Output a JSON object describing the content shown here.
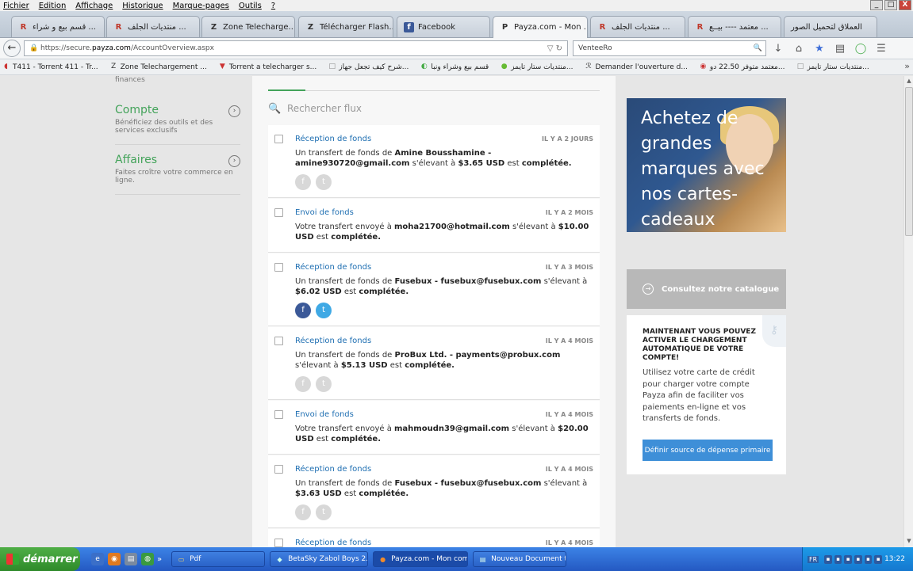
{
  "menubar": {
    "items": [
      "Fichier",
      "Edition",
      "Affichage",
      "Historique",
      "Marque-pages",
      "Outils",
      "?"
    ]
  },
  "window_controls": {
    "minimize": "_",
    "maximize": "□",
    "close": "X"
  },
  "tabs": [
    {
      "label": "قسم بيع و شراء ...",
      "icon": "R",
      "active": false
    },
    {
      "label": "منتديات الجلف ...",
      "icon": "R",
      "active": false
    },
    {
      "label": "Zone Telecharge...",
      "icon": "Z",
      "active": false
    },
    {
      "label": "Télécharger Flash...",
      "icon": "Z",
      "active": false
    },
    {
      "label": "Facebook",
      "icon": "f",
      "active": false
    },
    {
      "label": "Payza.com - Mon ...",
      "icon": "P",
      "active": true,
      "close": "×"
    },
    {
      "label": "منتديات الجلف ...",
      "icon": "R",
      "active": false
    },
    {
      "label": "معتمد ---- بيــع ...",
      "icon": "R",
      "active": false
    },
    {
      "label": "العملاق لتحميل الصور",
      "icon": "",
      "active": false
    }
  ],
  "nav": {
    "back": "←",
    "url_prefix": "https://secure.",
    "url_domain": "payza.com",
    "url_path": "/AccountOverview.aspx",
    "url_controls": "▽  ↻",
    "search_value": "VenteeRo",
    "search_icon": "🔍",
    "icons": [
      "↓",
      "⌂",
      "★",
      "▤",
      "◯",
      "☰"
    ]
  },
  "bookmarks": [
    "T411 - Torrent 411 - Tr...",
    "Zone Telechargement ...",
    "Torrent a telecharger s...",
    "شرح كيف تجعل جهاز...",
    "قسم بيع وشراء ونبا",
    "منتديات ستار تايمز...",
    "Demander l'ouverture d...",
    "معتمد متوفر 22.50 دو...",
    "منتديات ستار تايمز..."
  ],
  "bookmarks_more": "»",
  "sidebar": {
    "cut_text": "finances",
    "items": [
      {
        "title": "Compte",
        "desc": "Bénéficiez des outils et des services exclusifs",
        "arrow": "›"
      },
      {
        "title": "Affaires",
        "desc": "Faites croître votre commerce en ligne.",
        "arrow": "›"
      }
    ]
  },
  "feed": {
    "search_icon": "🔍",
    "search_placeholder": "Rechercher flux",
    "items": [
      {
        "title": "Réception de fonds",
        "date": "IL Y A 2 JOURS",
        "pre": "Un transfert de fonds de ",
        "party": "Amine Bousshamine - amine930720@gmail.com",
        "mid": " s'élevant à ",
        "amount": "$3.65 USD",
        "post": " est ",
        "status": "complétée.",
        "social": "grey"
      },
      {
        "title": "Envoi de fonds",
        "date": "IL Y A 2 MOIS",
        "pre": "Votre transfert envoyé à ",
        "party": "moha21700@hotmail.com",
        "mid": " s'élevant à ",
        "amount": "$10.00 USD",
        "post": " est ",
        "status": "complétée.",
        "social": "none"
      },
      {
        "title": "Réception de fonds",
        "date": "IL Y A 3 MOIS",
        "pre": "Un transfert de fonds de ",
        "party": "Fusebux - fusebux@fusebux.com",
        "mid": " s'élevant à ",
        "amount": "$6.02 USD",
        "post": " est ",
        "status": "complétée.",
        "social": "color"
      },
      {
        "title": "Réception de fonds",
        "date": "IL Y A 4 MOIS",
        "pre": "Un transfert de fonds de ",
        "party": "ProBux Ltd. - payments@probux.com",
        "mid": " s'élevant à ",
        "amount": "$5.13 USD",
        "post": " est ",
        "status": "complétée.",
        "social": "grey"
      },
      {
        "title": "Envoi de fonds",
        "date": "IL Y A 4 MOIS",
        "pre": "Votre transfert envoyé à ",
        "party": "mahmoudn39@gmail.com",
        "mid": " s'élevant à ",
        "amount": "$20.00 USD",
        "post": " est ",
        "status": "complétée.",
        "social": "none"
      },
      {
        "title": "Réception de fonds",
        "date": "IL Y A 4 MOIS",
        "pre": "Un transfert de fonds de ",
        "party": "Fusebux - fusebux@fusebux.com",
        "mid": " s'élevant à ",
        "amount": "$3.63 USD",
        "post": " est ",
        "status": "complétée.",
        "social": "grey"
      },
      {
        "title": "Réception de fonds",
        "date": "IL Y A 4 MOIS",
        "pre": "",
        "party": "",
        "mid": "",
        "amount": "",
        "post": "",
        "status": "",
        "social": "none"
      }
    ],
    "social_labels": {
      "facebook": "f",
      "twitter": "t"
    }
  },
  "ad": {
    "text": "Achetez de grandes marques avec nos cartes-cadeaux"
  },
  "catalog": {
    "icon": "→",
    "label": "Consultez notre catalogue"
  },
  "promo": {
    "title": "MAINTENANT VOUS POUVEZ ACTIVER LE CHARGEMENT AUTOMATIQUE DE VOTRE COMPTE!",
    "desc": "Utilisez votre carte de crédit pour charger votre compte Payza afin de faciliter vos paiements en-ligne et vos transferts de fonds.",
    "button": "Définir source de dépense primaire"
  },
  "scrollbar": {
    "up": "▲",
    "down": "▼"
  },
  "taskbar": {
    "start": "démarrer",
    "more": "»",
    "items": [
      {
        "label": "Pdf",
        "icon": "▭",
        "active": false
      },
      {
        "label": "BetaSky Zabol Boys 2...",
        "icon": "◆",
        "active": false
      },
      {
        "label": "Payza.com - Mon com...",
        "icon": "●",
        "active": true
      },
      {
        "label": "Nouveau Document t...",
        "icon": "▤",
        "active": false
      }
    ],
    "lang": "FR",
    "clock": "13:22"
  }
}
